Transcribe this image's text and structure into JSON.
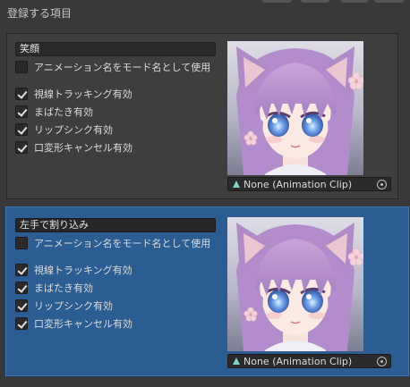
{
  "header": {
    "title": "登録する項目"
  },
  "items": [
    {
      "name": "笑顔",
      "use_anim_name": {
        "label": "アニメーション名をモード名として使用",
        "checked": false
      },
      "options": [
        {
          "label": "視線トラッキング有効",
          "checked": true
        },
        {
          "label": "まばたき有効",
          "checked": true
        },
        {
          "label": "リップシンク有効",
          "checked": true
        },
        {
          "label": "口変形キャンセル有効",
          "checked": true
        }
      ],
      "clip": {
        "value": "None (Animation Clip)",
        "icon": "animation-clip-icon"
      },
      "selected": false
    },
    {
      "name": "左手で割り込み",
      "use_anim_name": {
        "label": "アニメーション名をモード名として使用",
        "checked": false
      },
      "options": [
        {
          "label": "視線トラッキング有効",
          "checked": true
        },
        {
          "label": "まばたき有効",
          "checked": true
        },
        {
          "label": "リップシンク有効",
          "checked": true
        },
        {
          "label": "口変形キャンセル有効",
          "checked": true
        }
      ],
      "clip": {
        "value": "None (Animation Clip)",
        "icon": "animation-clip-icon"
      },
      "selected": true
    }
  ],
  "colors": {
    "panel": "#383838",
    "selected": "#2c5d92",
    "selected_border": "#3b77bc"
  }
}
